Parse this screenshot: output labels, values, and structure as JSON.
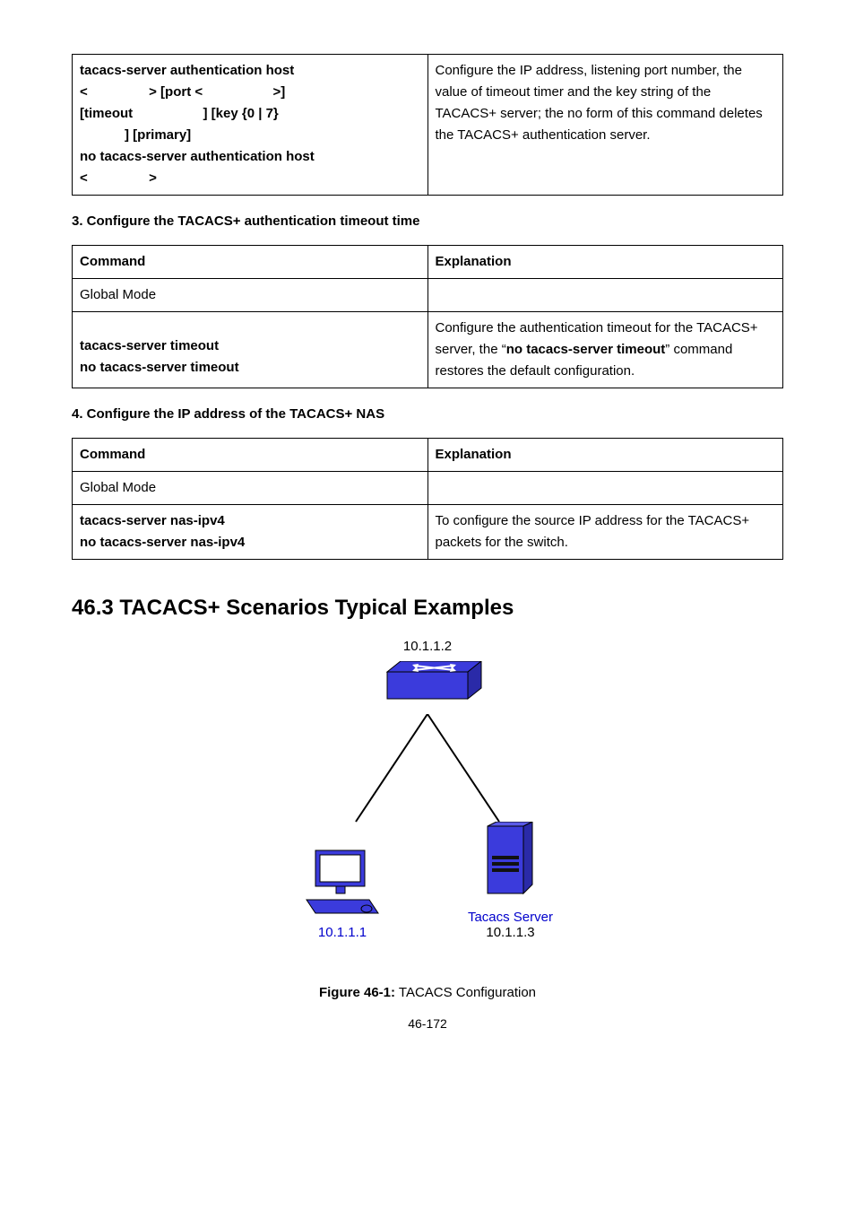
{
  "table1": {
    "cmd_l1": "tacacs-server authentication host",
    "cmd_l2a": "<",
    "cmd_l2b": "> [port <",
    "cmd_l2c": ">]",
    "cmd_l3a": "[timeout",
    "cmd_l3b": "] [key {0 | 7}",
    "cmd_l4": "] [primary]",
    "cmd_l5": "no tacacs-server authentication host",
    "cmd_l6a": "<",
    "cmd_l6b": ">",
    "expl": "Configure the IP address, listening port number, the value of timeout timer and the key string of the TACACS+ server; the no form of this command deletes the TACACS+ authentication server."
  },
  "sec3": "3. Configure the TACACS+ authentication timeout time",
  "table2": {
    "h1": "Command",
    "h2": "Explanation",
    "mode": "Global Mode",
    "cmd1": "tacacs-server timeout",
    "cmd2": "no tacacs-server timeout",
    "expl_a": "Configure the authentication timeout for the TACACS+ server, the “",
    "expl_b": "no tacacs-server timeout",
    "expl_c": "” command restores the default configuration."
  },
  "sec4": "4. Configure the IP address of the TACACS+ NAS",
  "table3": {
    "h1": "Command",
    "h2": "Explanation",
    "mode": "Global Mode",
    "cmd1": "tacacs-server nas-ipv4",
    "cmd2": "no tacacs-server nas-ipv4",
    "expl": "To configure the source IP address for the TACACS+ packets for the switch."
  },
  "heading": "46.3 TACACS+ Scenarios Typical Examples",
  "diagram": {
    "ip_top": "10.1.1.2",
    "label_left": "10.1.1.1",
    "label_right": "Tacacs Server",
    "ip_right": "10.1.1.3"
  },
  "figure_label_b": "Figure 46-1:",
  "figure_label_rest": " TACACS Configuration",
  "page": "46-172"
}
